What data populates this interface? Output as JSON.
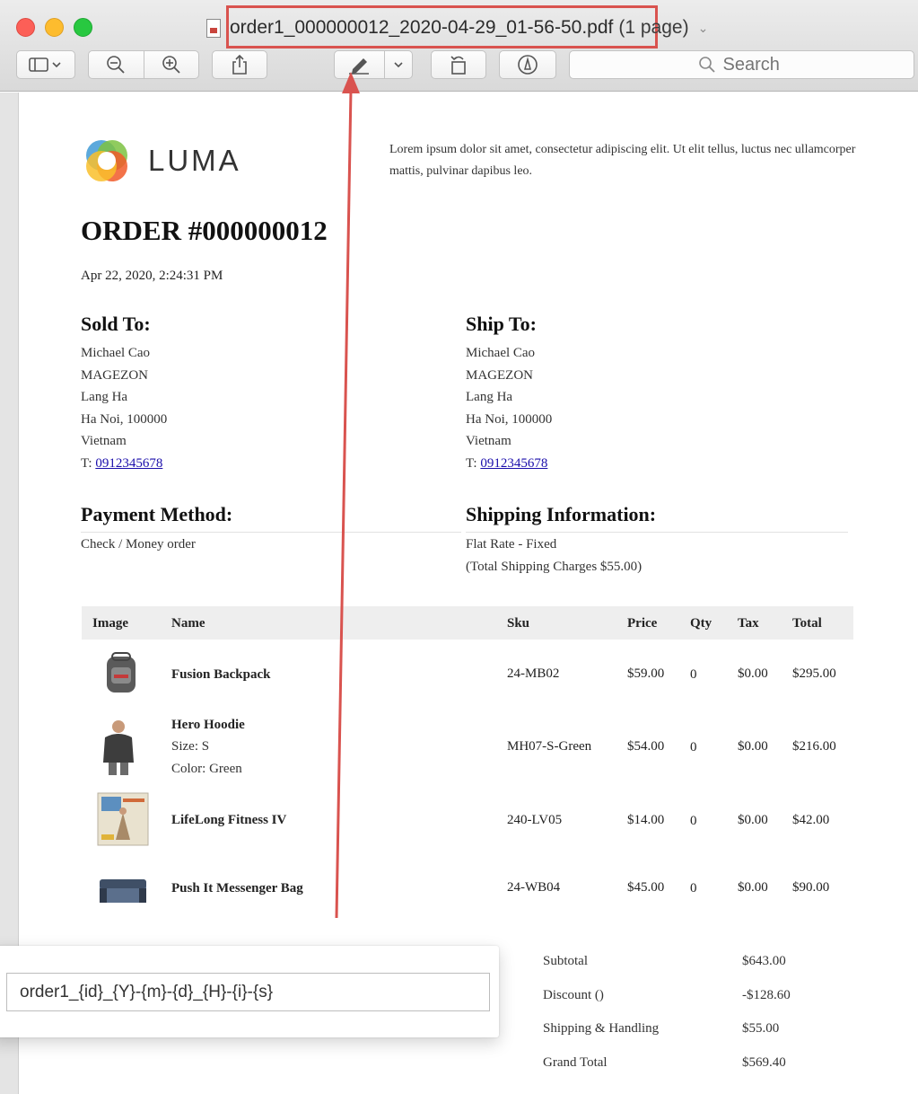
{
  "window": {
    "title": "order1_000000012_2020-04-29_01-56-50.pdf",
    "page_info": "(1 page)"
  },
  "toolbar": {
    "search_placeholder": "Search"
  },
  "store": {
    "logo_text": "LUMA",
    "header_note": "Lorem ipsum dolor sit amet, consectetur adipiscing elit. Ut elit tellus, luctus nec ullamcorper mattis, pulvinar dapibus leo."
  },
  "order": {
    "title": "ORDER #000000012",
    "date": "Apr 22, 2020, 2:24:31 PM"
  },
  "sold_to": {
    "heading": "Sold To:",
    "name": "Michael Cao",
    "company": "MAGEZON",
    "street": "Lang Ha",
    "city": "Ha Noi, 100000",
    "country": "Vietnam",
    "phone_prefix": "T:",
    "phone": "0912345678"
  },
  "ship_to": {
    "heading": "Ship To:",
    "name": "Michael Cao",
    "company": "MAGEZON",
    "street": "Lang Ha",
    "city": "Ha Noi, 100000",
    "country": "Vietnam",
    "phone_prefix": "T:",
    "phone": "0912345678"
  },
  "payment": {
    "heading": "Payment Method:",
    "method": "Check / Money order"
  },
  "shipping": {
    "heading": "Shipping Information:",
    "method": "Flat Rate - Fixed",
    "charges": "(Total Shipping Charges $55.00)"
  },
  "items_table": {
    "headers": {
      "image": "Image",
      "name": "Name",
      "sku": "Sku",
      "price": "Price",
      "qty": "Qty",
      "tax": "Tax",
      "total": "Total"
    },
    "rows": [
      {
        "name": "Fusion Backpack",
        "options": [],
        "sku": "24-MB02",
        "price": "$59.00",
        "qty": "0",
        "tax": "$0.00",
        "total": "$295.00"
      },
      {
        "name": "Hero Hoodie",
        "options": [
          "Size: S",
          "Color: Green"
        ],
        "sku": "MH07-S-Green",
        "price": "$54.00",
        "qty": "0",
        "tax": "$0.00",
        "total": "$216.00"
      },
      {
        "name": "LifeLong Fitness IV",
        "options": [],
        "sku": "240-LV05",
        "price": "$14.00",
        "qty": "0",
        "tax": "$0.00",
        "total": "$42.00"
      },
      {
        "name": "Push It Messenger Bag",
        "options": [],
        "sku": "24-WB04",
        "price": "$45.00",
        "qty": "0",
        "tax": "$0.00",
        "total": "$90.00"
      }
    ]
  },
  "totals": {
    "subtotal_label": "Subtotal",
    "subtotal": "$643.00",
    "discount_label": "Discount ()",
    "discount": "-$128.60",
    "shipping_label": "Shipping & Handling",
    "shipping": "$55.00",
    "grand_total_label": "Grand Total",
    "grand_total": "$569.40"
  },
  "filename_pattern": {
    "value": "order1_{id}_{Y}-{m}-{d}_{H}-{i}-{s}"
  },
  "colors": {
    "highlight": "#d9534f",
    "link": "#1a0dab"
  }
}
